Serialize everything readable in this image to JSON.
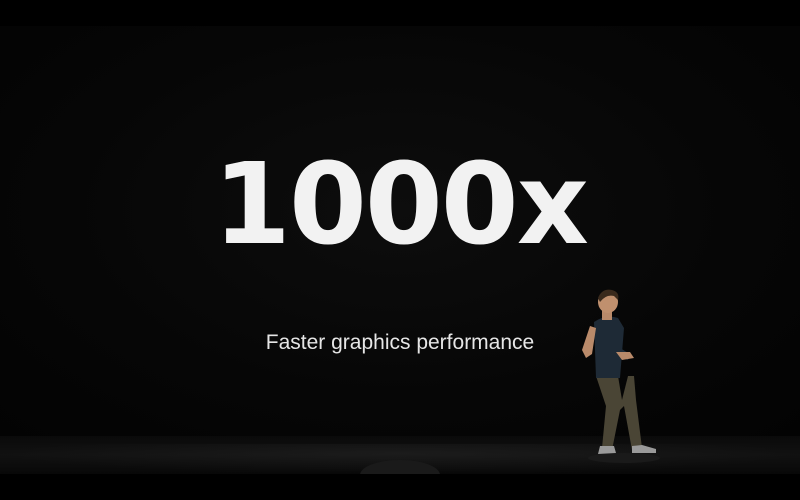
{
  "slide": {
    "headline": "1000x",
    "subtitle": "Faster graphics performance"
  },
  "colors": {
    "background": "#050505",
    "headline_text": "#f2f2f2",
    "subtitle_text": "#e6e6e6"
  }
}
